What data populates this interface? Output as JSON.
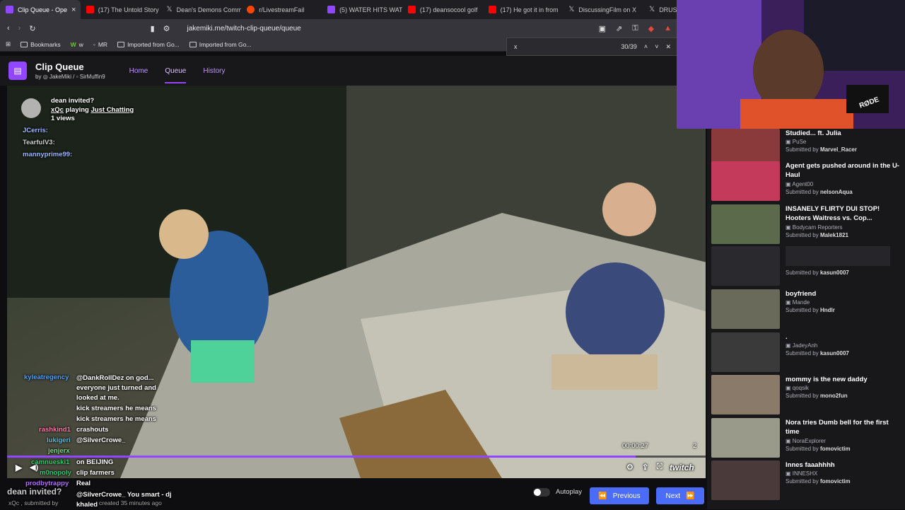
{
  "tabs": [
    {
      "label": "Clip Queue - Ope",
      "color": "#9146ff",
      "active": true
    },
    {
      "label": "(17) The Untold Story",
      "color": "#ff0000"
    },
    {
      "label": "Dean's Demons Comm",
      "color": "#000000"
    },
    {
      "label": "r/LivestreamFail",
      "color": "#ff4500"
    },
    {
      "label": "(5) WATER HITS WATER",
      "color": "#9146ff"
    },
    {
      "label": "(17) deansocool golf",
      "color": "#ff0000"
    },
    {
      "label": "(17) He got it in from",
      "color": "#ff0000"
    },
    {
      "label": "DiscussingFilm on X",
      "color": "#000000"
    },
    {
      "label": "DRUS",
      "color": "#000000"
    }
  ],
  "address": {
    "url": "jakemiki.me/twitch-clip-queue/queue"
  },
  "bookmarks": [
    {
      "label": "Bookmarks"
    },
    {
      "label": "w"
    },
    {
      "label": "MR"
    },
    {
      "label": "Imported from Go..."
    },
    {
      "label": "Imported from Go..."
    }
  ],
  "find": {
    "query": "x",
    "count": "30/39"
  },
  "header": {
    "title": "Clip Queue",
    "by": "by",
    "author1": "JakeMiki",
    "author2": "SirMuffin9",
    "nav": {
      "home": "Home",
      "queue": "Queue",
      "history": "History"
    }
  },
  "overlay": {
    "raid_title": "dean invited?",
    "raid_user": "xQc",
    "raid_playing": "playing",
    "raid_game": "Just Chatting",
    "raid_views": "1 views"
  },
  "chat_top": [
    {
      "user": "JCerris:",
      "color": "#9db8ff"
    },
    {
      "user": "TearfulV3:",
      "color": "#cfcfcf"
    },
    {
      "user": "mannyprime99:",
      "color": "#9db8ff"
    }
  ],
  "chat_bottom": [
    {
      "user": "kyleatregency",
      "msg": "@DankRollDez on god... everyone just turned and looked at me.",
      "color": "#4aa3ff"
    },
    {
      "user": "",
      "msg": "kick streamers he means",
      "color": "#9146ff"
    },
    {
      "user": "",
      "msg": "kick streamers he means",
      "color": "#9146ff"
    },
    {
      "user": "rashkind1",
      "msg": "crashouts",
      "color": "#ff7aa8"
    },
    {
      "user": "lukigeri",
      "msg": "@SilverCrowe_",
      "color": "#5bc0de"
    },
    {
      "user": "jenjerx",
      "msg": "",
      "color": "#7bd88f"
    },
    {
      "user": "camnueski1",
      "msg": "on BEIJING",
      "color": "#2ecc71"
    },
    {
      "user": "m0nopoly",
      "msg": "clip farmers",
      "color": "#2ecc71"
    },
    {
      "user": "prodbytrappy",
      "msg": "Real",
      "color": "#b36bff"
    },
    {
      "user": "",
      "msg": "@SilverCrowe_ You smart - dj khaled",
      "color": "#ff4f4f"
    }
  ],
  "player": {
    "time": "00:00:27",
    "count": "2",
    "progress": 0.9,
    "brand": "twitch"
  },
  "clip_info": {
    "text": "xQc , submitted by",
    "created": "created 35 minutes ago",
    "raid_echo": "dean invited?"
  },
  "controls": {
    "autoplay": "Autoplay",
    "previous": "Previous",
    "next": "Next"
  },
  "queue": [
    {
      "title": "Studied... ft. Julia",
      "author": "PuSe",
      "submitted": "Marvel_Racer",
      "thumb": "#8a3a3a"
    },
    {
      "title": "Agent gets pushed around in the U-Haul",
      "author": "Agent00",
      "submitted": "nelsonAqua",
      "thumb": "#c43a5a"
    },
    {
      "title": "INSANELY FLIRTY DUI STOP! Hooters Waitress vs. Cop...",
      "author": "Bodycam Reporters",
      "submitted": "Malek1821",
      "thumb": "#5a6a4a"
    },
    {
      "title": "",
      "author": "",
      "submitted": "kasun0007",
      "thumb": "#2a2a2e"
    },
    {
      "title": "boyfriend",
      "author": "Mande",
      "submitted": "Hndlr",
      "thumb": "#6a6a5a"
    },
    {
      "title": ".",
      "author": "JadeyAnh",
      "submitted": "kasun0007",
      "thumb": "#3a3a3a"
    },
    {
      "title": "mommy is the new daddy",
      "author": "qoqsik",
      "submitted": "mono2fun",
      "thumb": "#8a7a6a"
    },
    {
      "title": "Nora tries Dumb bell for the first time",
      "author": "NoraExplorer",
      "submitted": "fomovictim",
      "thumb": "#9a9a8a"
    },
    {
      "title": "Innes faaahhhh",
      "author": "INNESHX",
      "submitted": "fomovictim",
      "thumb": "#4a3a3a"
    }
  ],
  "queue_submitted_label": "Submitted by",
  "webcam": {
    "brand": "RØDE"
  }
}
